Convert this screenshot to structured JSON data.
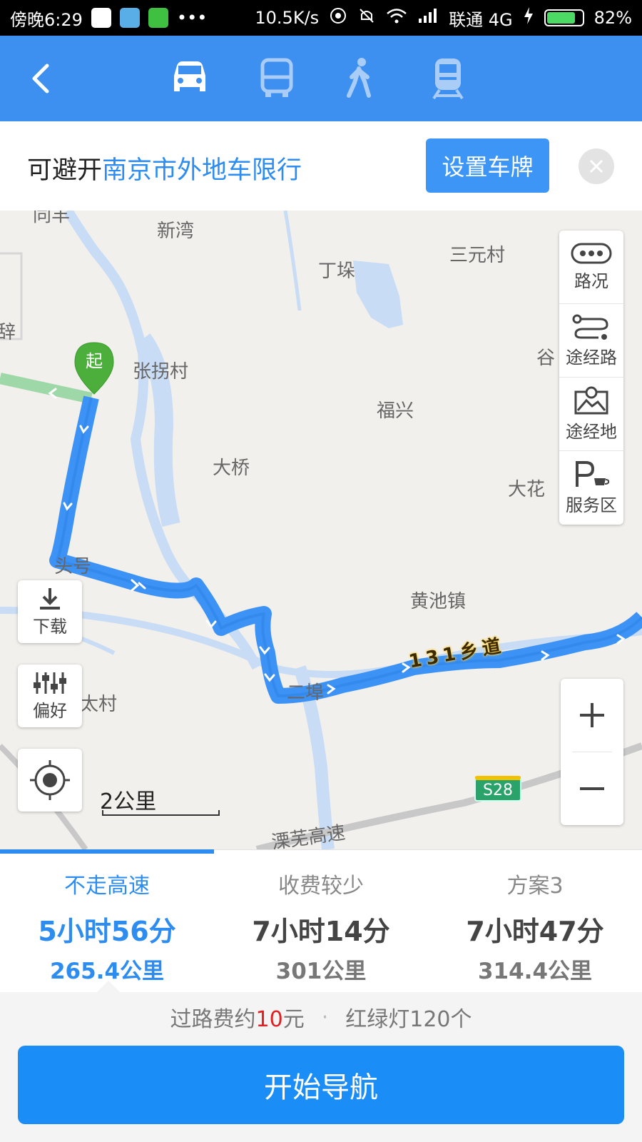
{
  "status_bar": {
    "time": "傍晚6:29",
    "more": "•••",
    "speed": "10.5K/s",
    "carrier": "联通 4G",
    "battery": "82%",
    "battery_level": 0.82
  },
  "nav": {
    "modes": [
      "car-icon",
      "bus-icon",
      "walk-icon",
      "train-icon"
    ],
    "active_mode": "car"
  },
  "banner": {
    "prefix": "可避开",
    "highlight": "南京市外地车限行",
    "button_label": "设置车牌"
  },
  "map": {
    "places": [
      "同羊",
      "新湾",
      "丁垛",
      "三元村",
      "辞",
      "张拐村",
      "谷",
      "福兴",
      "大桥",
      "大花",
      "头号",
      "黄池镇",
      "二埠",
      "太村",
      "溧芜高速"
    ],
    "road_label": "131乡道",
    "highway_shield": "S28",
    "start_marker": "起",
    "side_panel": [
      {
        "label": "路况",
        "icon": "traffic-icon"
      },
      {
        "label": "途经路",
        "icon": "waypoint-road-icon"
      },
      {
        "label": "途经地",
        "icon": "waypoint-place-icon"
      },
      {
        "label": "服务区",
        "icon": "service-area-icon"
      }
    ],
    "download_label": "下载",
    "preference_label": "偏好",
    "scale_label": "2公里"
  },
  "routes": [
    {
      "name": "不走高速",
      "time": "5小时56分",
      "distance": "265.4公里"
    },
    {
      "name": "收费较少",
      "time": "7小时14分",
      "distance": "301公里"
    },
    {
      "name": "方案3",
      "time": "7小时47分",
      "distance": "314.4公里"
    }
  ],
  "info": {
    "toll_prefix": "过路费约",
    "toll_value": "10",
    "toll_unit": "元",
    "separator": "·",
    "lights": "红绿灯120个"
  },
  "start_button": "开始导航",
  "colors": {
    "nav_blue": "#3d8ff0",
    "route_blue": "#2d8cf0",
    "toll_red": "#e02020",
    "start_green": "#4caf3c"
  }
}
